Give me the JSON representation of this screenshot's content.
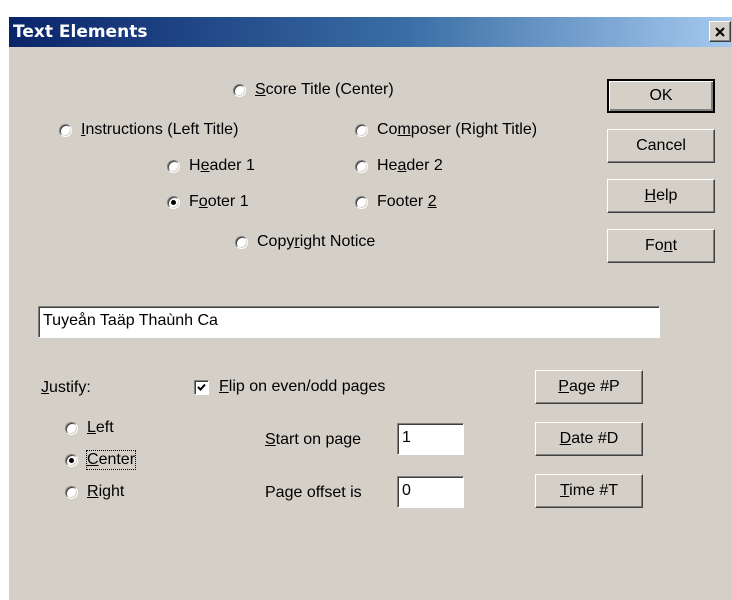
{
  "window": {
    "title": "Text Elements"
  },
  "radios": [
    {
      "id": "score-title",
      "prefix": "",
      "accel": "S",
      "rest": "core Title (Center)",
      "checked": false
    },
    {
      "id": "instructions",
      "prefix": "",
      "accel": "I",
      "rest": "nstructions (Left Title)",
      "checked": false
    },
    {
      "id": "composer",
      "prefix": "Co",
      "accel": "m",
      "rest": "poser (Right Title)",
      "checked": false
    },
    {
      "id": "header-1",
      "prefix": "H",
      "accel": "e",
      "rest": "ader 1",
      "checked": false
    },
    {
      "id": "header-2",
      "prefix": "He",
      "accel": "a",
      "rest": "der 2",
      "checked": false
    },
    {
      "id": "footer-1",
      "prefix": "F",
      "accel": "o",
      "rest": "oter 1",
      "checked": true
    },
    {
      "id": "footer-2",
      "prefix": "Footer ",
      "accel": "2",
      "rest": "",
      "checked": false
    },
    {
      "id": "copyright",
      "prefix": "Copy",
      "accel": "r",
      "rest": "ight Notice",
      "checked": false
    }
  ],
  "buttons": {
    "ok": "OK",
    "cancel": "Cancel",
    "help": {
      "accel": "H",
      "rest": "elp"
    },
    "font": {
      "prefix": "Fo",
      "accel": "n",
      "rest": "t"
    },
    "page": {
      "accel": "P",
      "rest": "age #P"
    },
    "date": {
      "accel": "D",
      "rest": "ate #D"
    },
    "time": {
      "accel": "T",
      "rest": "ime #T"
    }
  },
  "text_value": "Tuyeån Taäp Thaùnh Ca",
  "justify": {
    "label": {
      "accel": "J",
      "rest": "ustify:"
    },
    "options": [
      {
        "id": "left",
        "accel": "L",
        "rest": "eft",
        "checked": false
      },
      {
        "id": "center",
        "accel": "C",
        "rest": "enter",
        "checked": true
      },
      {
        "id": "right",
        "accel": "R",
        "rest": "ight",
        "checked": false
      }
    ]
  },
  "flip": {
    "accel": "F",
    "rest": "lip on even/odd pages",
    "checked": true
  },
  "start_page": {
    "label_accel": "S",
    "label_rest": "tart on page",
    "value": "1"
  },
  "page_offset": {
    "label": "Page offset is",
    "value": "0"
  }
}
